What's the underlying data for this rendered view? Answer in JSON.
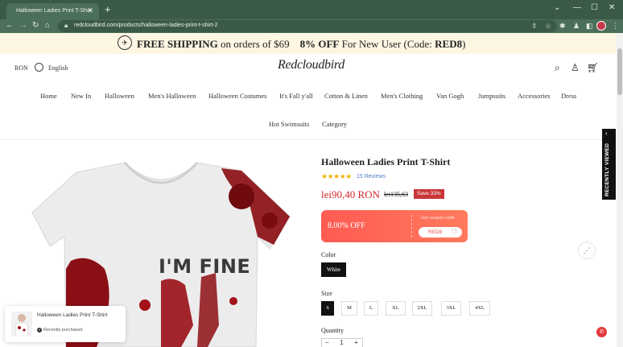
{
  "browser": {
    "tab_title": "Halloween Ladies Print T-Shirt",
    "url": "redcloudbird.com/products/halloween-ladies-print-t-shirt-2"
  },
  "promo": {
    "free_shipping": "FREE SHIPPING",
    "orders_text": " on orders of $69",
    "discount": "8% OFF",
    "new_user": " For New User (Code: ",
    "code": "RED8",
    "close": ")"
  },
  "header": {
    "currency": "RON",
    "language": "English",
    "logo": "Redcloudbird"
  },
  "nav": [
    "Home",
    "New In",
    "Halloween",
    "Men's Halloween",
    "Halloween Costumes",
    "It's Fall y'all",
    "Cotton & Linen",
    "Men's Clothing",
    "Van Gogh",
    "Jumpsuits",
    "Accessories",
    "Dress",
    "Hot Swimsuits",
    "Category"
  ],
  "product": {
    "title": "Halloween Ladies Print T-Shirt",
    "rating": 5,
    "reviews": "15 Reviews",
    "price": "lei90,40 RON",
    "old_price": "lei135,63",
    "save": "Save 33%",
    "image_text": "I'M FINE"
  },
  "coupon": {
    "off": "8.00% OFF",
    "get_label": "Get coupon code",
    "code": "RED8"
  },
  "color": {
    "label": "Color",
    "selected": "White"
  },
  "size": {
    "label": "Size",
    "options": [
      "S",
      "M",
      "L",
      "XL",
      "2XL",
      "3XL",
      "4XL"
    ],
    "selected": "S"
  },
  "quantity": {
    "label": "Quantity",
    "value": "1"
  },
  "recently_viewed": "RECENTLY VIEWED",
  "toast": {
    "title": "Halloween Ladies Print T-Shirt",
    "status": "Recently purchased"
  },
  "colors": {
    "chrome": "#3a5a46",
    "accent": "#d4262d",
    "coupon": "#ff5b53"
  }
}
